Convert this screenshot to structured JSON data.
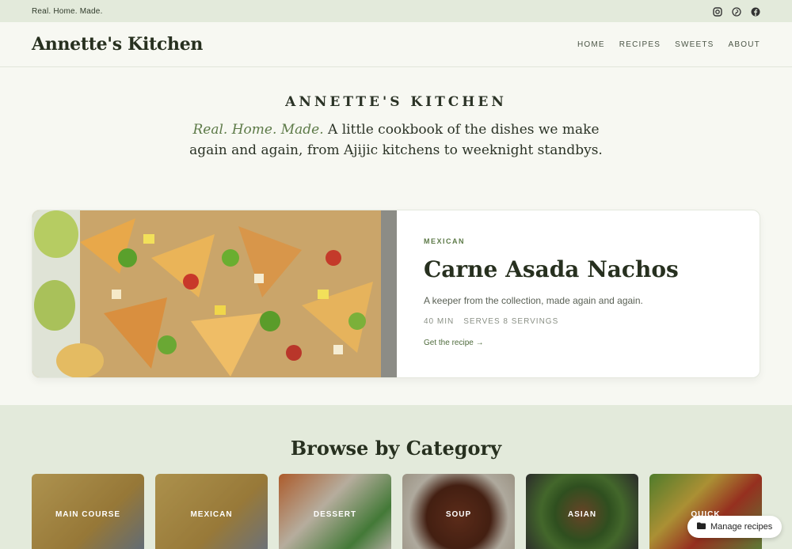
{
  "topbar": {
    "tagline": "Real. Home. Made."
  },
  "header": {
    "logo": "Annette's Kitchen",
    "nav": [
      "HOME",
      "RECIPES",
      "SWEETS",
      "ABOUT"
    ]
  },
  "hero": {
    "title": "ANNETTE'S KITCHEN",
    "tagline_em": "Real. Home. Made.",
    "text": " A little cookbook of the dishes we make again and again, from Ajijic kitchens to weeknight standbys."
  },
  "featured": {
    "category": "MEXICAN",
    "title": "Carne Asada Nachos",
    "description": "A keeper from the collection, made again and again.",
    "time": "40 MIN",
    "serves": "SERVES 8 SERVINGS",
    "cta": "Get the recipe →"
  },
  "categories": {
    "heading": "Browse by Category",
    "items": [
      "MAIN COURSE",
      "MEXICAN",
      "DESSERT",
      "SOUP",
      "ASIAN",
      "QUICK"
    ]
  },
  "manage": {
    "label": "Manage recipes"
  }
}
